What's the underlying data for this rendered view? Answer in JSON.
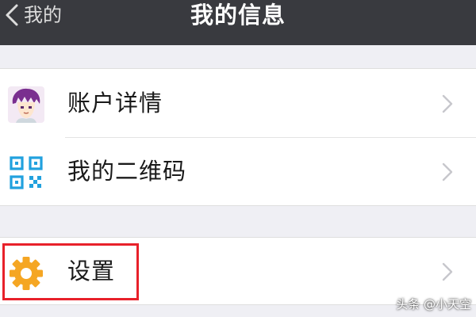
{
  "navbar": {
    "back_label": "我的",
    "title": "我的信息",
    "background_color": "#393a3f"
  },
  "groups": [
    {
      "items": [
        {
          "id": "account",
          "label": "账户详情",
          "icon": "avatar-icon"
        },
        {
          "id": "qrcode",
          "label": "我的二维码",
          "icon": "qrcode-icon"
        }
      ]
    },
    {
      "items": [
        {
          "id": "settings",
          "label": "设置",
          "icon": "gear-icon",
          "highlighted": true
        }
      ]
    }
  ],
  "colors": {
    "page_background": "#efeff4",
    "row_background": "#ffffff",
    "highlight": "#e8212a",
    "gear": "#f5a623",
    "qrcode": "#21a1de"
  },
  "watermark": "头条 @小天空"
}
